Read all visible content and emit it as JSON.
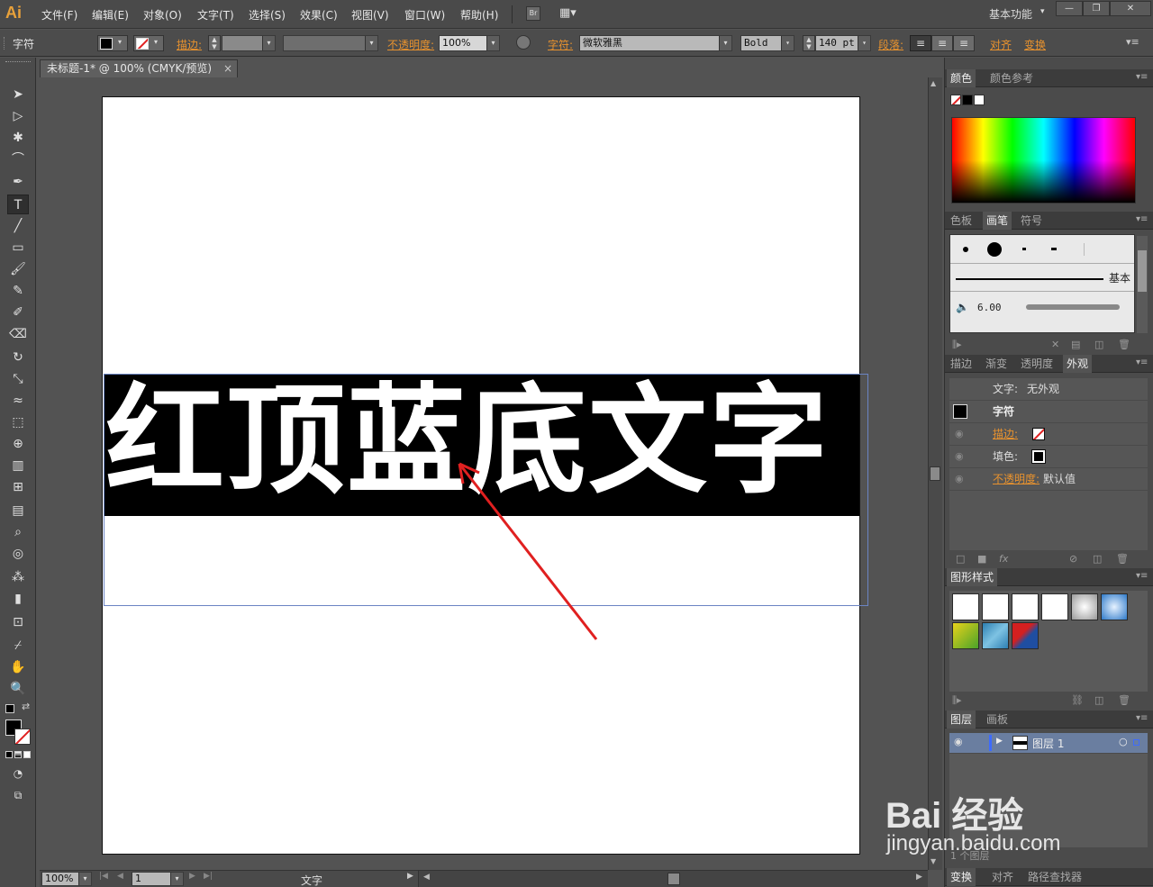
{
  "app": {
    "logo": "Ai",
    "workspace": "基本功能"
  },
  "menu": [
    "文件(F)",
    "编辑(E)",
    "对象(O)",
    "文字(T)",
    "选择(S)",
    "效果(C)",
    "视图(V)",
    "窗口(W)",
    "帮助(H)"
  ],
  "bridge_label": "Br",
  "window_controls": {
    "min": "—",
    "restore": "❐",
    "close": "✕"
  },
  "control": {
    "panel_label": "字符",
    "stroke_label": "描边:",
    "opacity_label": "不透明度:",
    "opacity_value": "100%",
    "char_label": "字符:",
    "font_family": "微软雅黑",
    "font_style": "Bold",
    "font_size": "140 pt",
    "paragraph_label": "段落:",
    "align_label": "对齐",
    "transform_label": "变换"
  },
  "document": {
    "tab_title": "未标题-1* @ 100% (CMYK/预览)",
    "tab_close": "×",
    "artboard_text": "红顶蓝底文字"
  },
  "status": {
    "zoom": "100%",
    "page": "1",
    "tool": "文字"
  },
  "panels": {
    "color": {
      "tabs": [
        "颜色",
        "颜色参考"
      ]
    },
    "brushes": {
      "tabs": [
        "色板",
        "画笔",
        "符号"
      ],
      "basic_label": "基本",
      "size_value": "6.00"
    },
    "appearance": {
      "tabs": [
        "描边",
        "渐变",
        "透明度",
        "外观"
      ],
      "text_row_label": "文字:",
      "text_row_value": "无外观",
      "char_row": "字符",
      "stroke_row": "描边:",
      "fill_row": "填色:",
      "opacity_row": "不透明度:",
      "opacity_value": "默认值",
      "fx_label": "fx"
    },
    "graphic_styles": {
      "tabs": [
        "图形样式"
      ]
    },
    "layers": {
      "tabs": [
        "图层",
        "画板"
      ],
      "layer_name": "图层 1",
      "layer_count": "1 个图层"
    },
    "bottom": {
      "tabs": [
        "变换",
        "对齐",
        "路径查找器"
      ]
    }
  },
  "watermark": {
    "text": "Bai 经验",
    "url": "jingyan.baidu.com"
  },
  "colors": {
    "accent": "#e8922e",
    "arrow": "#e02020",
    "selection": "#6b84c3"
  }
}
